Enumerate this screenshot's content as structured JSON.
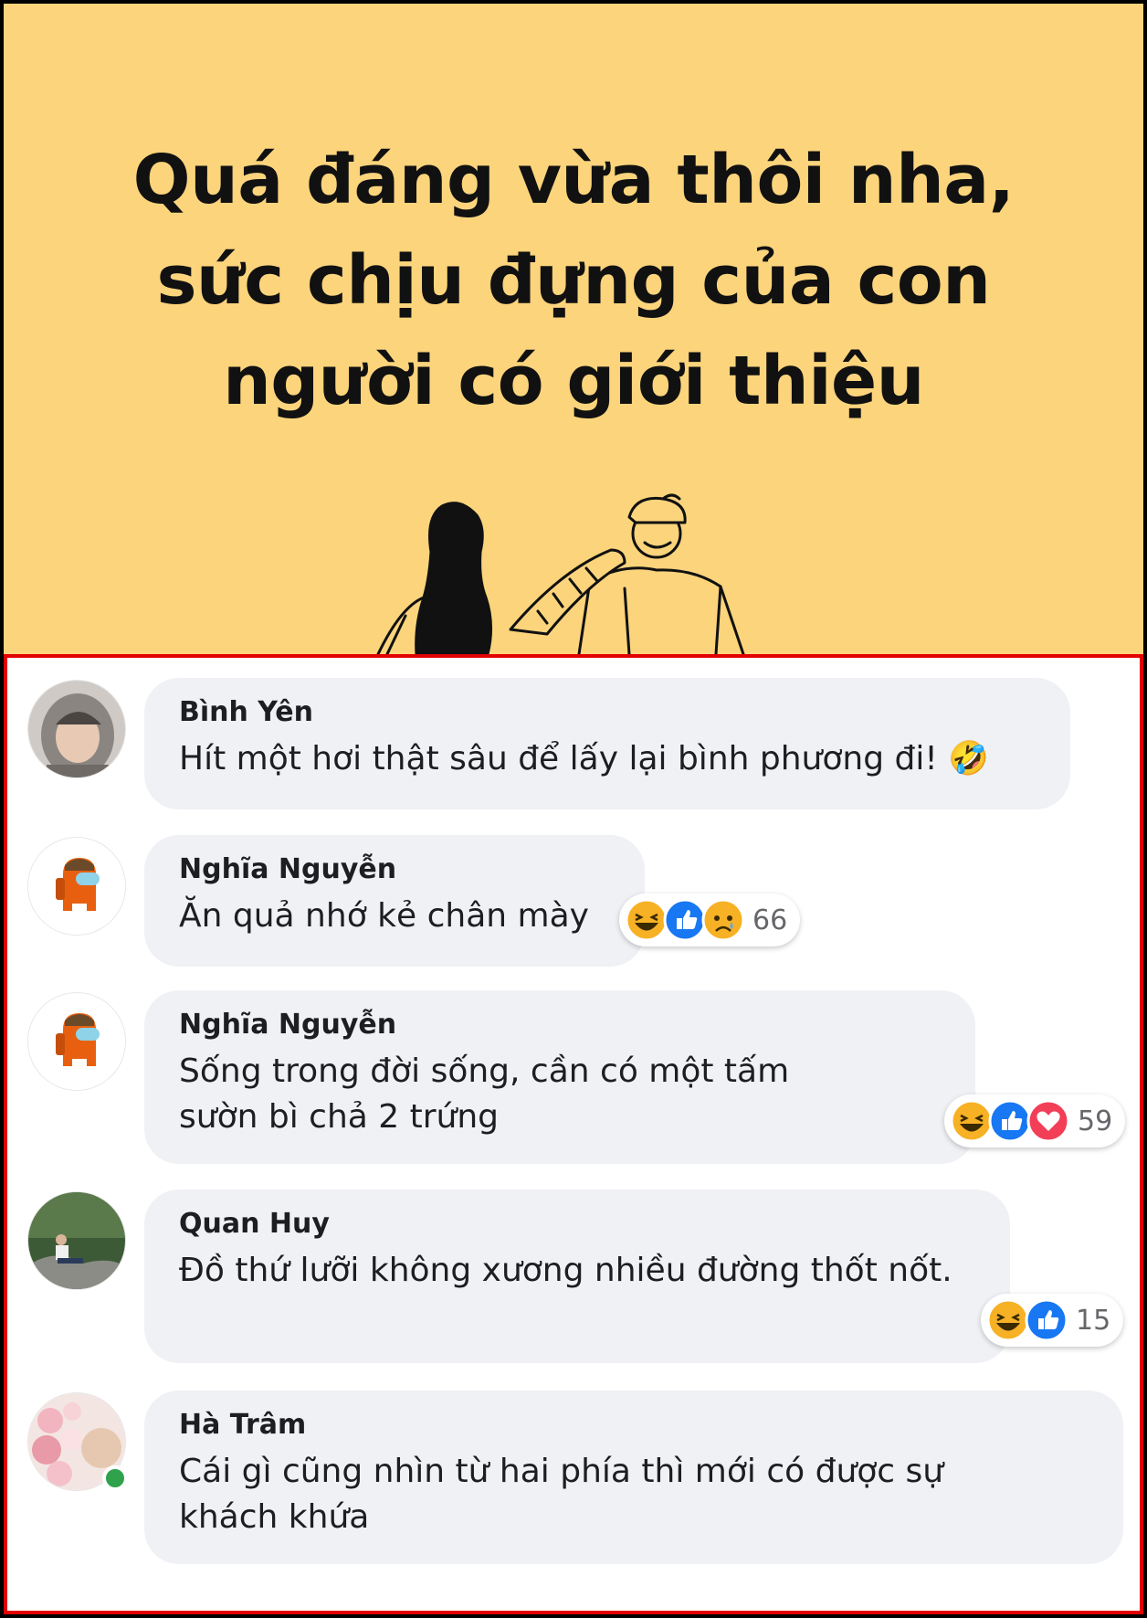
{
  "post": {
    "headline_lines": [
      "Quá đáng vừa thôi nha,",
      "sức chịu đựng của con",
      "người có giới thiệu"
    ],
    "background_color": "#fbd47c"
  },
  "comments": [
    {
      "author": "Bình Yên",
      "text": "Hít một hơi thật sâu để lấy lại bình phương đi! 🤣",
      "avatar": "hooded-person-avatar"
    },
    {
      "author": "Nghĩa Nguyễn",
      "text": "Ăn quả nhớ kẻ chân mày",
      "avatar": "among-us-crewmate-avatar",
      "reactions": [
        "haha",
        "like",
        "sad"
      ],
      "reaction_count": "66"
    },
    {
      "author": "Nghĩa Nguyễn",
      "text": "Sống trong đời sống, cần có một tấm sườn bì chả 2 trứng",
      "avatar": "among-us-crewmate-avatar",
      "reactions": [
        "haha",
        "like",
        "love"
      ],
      "reaction_count": "59"
    },
    {
      "author": "Quan Huy",
      "text": "Đồ thứ lưỡi không xương nhiều đường thốt nốt.",
      "avatar": "man-on-rock-avatar",
      "reactions": [
        "haha",
        "like"
      ],
      "reaction_count": "15"
    },
    {
      "author": "Hà Trâm",
      "text": "Cái gì cũng nhìn từ hai phía thì mới có được sự khách khứa",
      "avatar": "flowers-avatar",
      "online": true
    }
  ],
  "colors": {
    "highlight_border": "#e30000",
    "bubble": "#eff1f4",
    "like": "#1877f2",
    "love": "#f33e58",
    "haha": "#f7b125",
    "online": "#31a24c"
  }
}
